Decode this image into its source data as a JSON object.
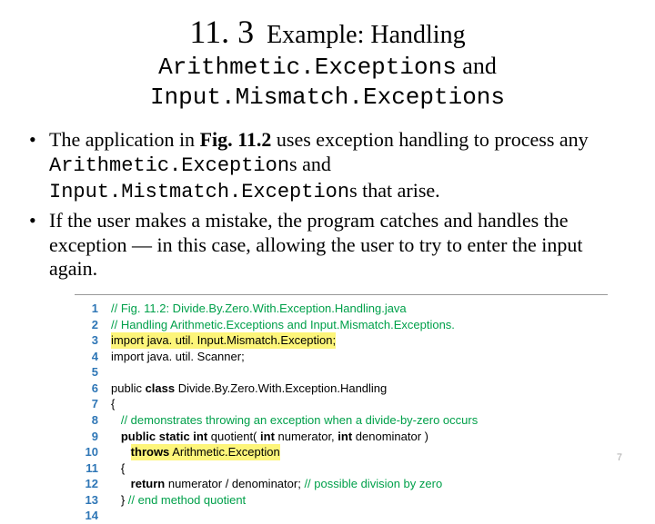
{
  "title": {
    "section_number": "11. 3",
    "heading_word": "Example: Handling",
    "code_line_1": "Arithmetic.Exceptions",
    "and_word_1": " and",
    "code_line_2": "Input.Mismatch.Exceptions"
  },
  "bullets": {
    "b1_prefix": "The application in ",
    "b1_figref": "Fig. 11.2",
    "b1_mid1": " uses exception handling to process any ",
    "b1_code1": "Arithmetic.Exception",
    "b1_mid2": "s and ",
    "b1_code2": "Input.Mistmatch.Exception",
    "b1_suffix": "s that arise.",
    "b2": "If the user makes a mistake, the program catches and handles the exception — in this case, allowing the user to try to enter the input again."
  },
  "code": {
    "l1": "// Fig. 11.2: Divide.By.Zero.With.Exception.Handling.java",
    "l2": "// Handling Arithmetic.Exceptions and Input.Mismatch.Exceptions.",
    "l3": "import java. util. Input.Mismatch.Exception;",
    "l4": "import java. util. Scanner;",
    "l5": "",
    "l6_public": "public ",
    "l6_class": "class",
    "l6_rest": " Divide.By.Zero.With.Exception.Handling",
    "l7": "{",
    "l8": "   // demonstrates throwing an exception when a divide-by-zero occurs",
    "l9_a": "   ",
    "l9_kw": "public static int",
    "l9_b": " quotient( ",
    "l9_kw2": "int",
    "l9_c": " numerator, ",
    "l9_kw3": "int",
    "l9_d": " denominator )",
    "l10_indent": "      ",
    "l10_kw": "throws",
    "l10_rest": " Arithmetic.Exception",
    "l11": "   {",
    "l12_a": "      ",
    "l12_kw": "return",
    "l12_b": " numerator / denominator; ",
    "l12_c": "// possible division by zero",
    "l13_a": "   } ",
    "l13_c": "// end method quotient",
    "l14": ""
  },
  "page_number": "7"
}
